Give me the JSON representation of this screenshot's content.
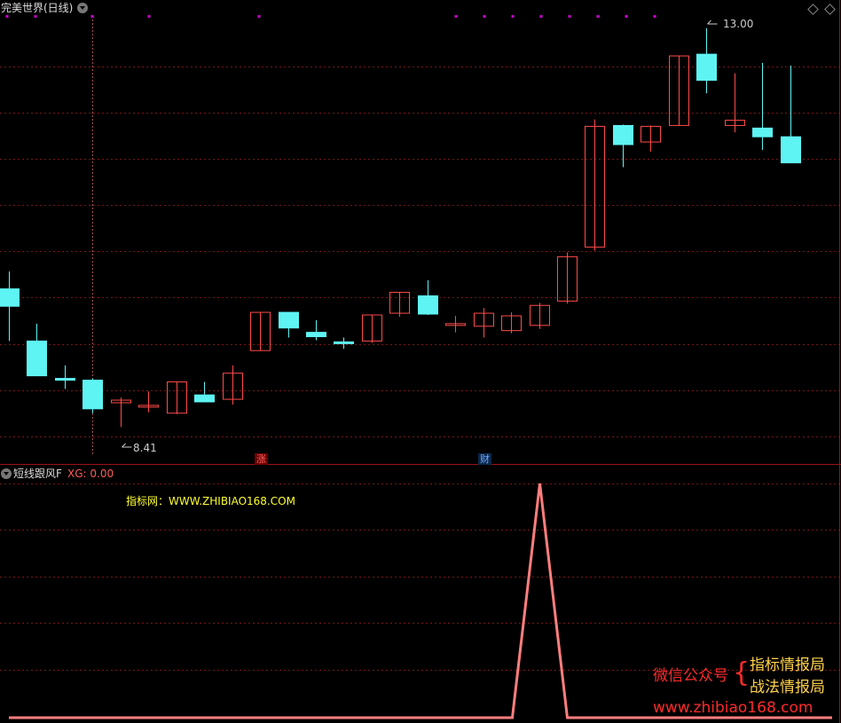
{
  "main_panel": {
    "title": "完美世界(日线)",
    "high_label": "13.00",
    "low_label": "8.41",
    "events": [
      {
        "text": "涨",
        "candle": 9
      },
      {
        "text": "财",
        "candle": 17
      }
    ]
  },
  "indicator_panel": {
    "title": "短线跟风F",
    "xg_label": "XG: 0.00",
    "watermark": "指标网：WWW.ZHIBIAO168.COM"
  },
  "branding": {
    "wechat_label": "微信公众号",
    "account_1": "指标情报局",
    "account_2": "战法情报局",
    "url": "www.zhibiao168.com"
  },
  "colors": {
    "up": "#ff4a4a",
    "down": "#5ff4f4",
    "grid": "#7a1515",
    "signal_line": "#ff7e7e",
    "marker": "#cc00cc"
  },
  "chart_data": [
    {
      "type": "candlestick",
      "title": "完美世界(日线)",
      "ylim": [
        8.2,
        13.15
      ],
      "series": [
        {
          "open": 10.0,
          "high": 10.2,
          "low": 9.4,
          "close": 9.8
        },
        {
          "open": 9.4,
          "high": 9.6,
          "low": 9.6,
          "close": 9.0
        },
        {
          "open": 8.97,
          "high": 9.12,
          "low": 8.85,
          "close": 8.95
        },
        {
          "open": 8.95,
          "high": 8.97,
          "low": 8.57,
          "close": 8.62
        },
        {
          "open": 8.69,
          "high": 8.75,
          "low": 8.41,
          "close": 8.72
        },
        {
          "open": 8.64,
          "high": 8.82,
          "low": 8.58,
          "close": 8.66
        },
        {
          "open": 8.57,
          "high": 8.93,
          "low": 8.56,
          "close": 8.93
        },
        {
          "open": 8.78,
          "high": 8.93,
          "low": 8.75,
          "close": 8.7
        },
        {
          "open": 8.73,
          "high": 9.12,
          "low": 8.67,
          "close": 9.03
        },
        {
          "open": 9.29,
          "high": 9.73,
          "low": 9.29,
          "close": 9.73
        },
        {
          "open": 9.73,
          "high": 9.65,
          "low": 9.44,
          "close": 9.55
        },
        {
          "open": 9.5,
          "high": 9.64,
          "low": 9.41,
          "close": 9.45
        },
        {
          "open": 9.39,
          "high": 9.44,
          "low": 9.31,
          "close": 9.37
        },
        {
          "open": 9.4,
          "high": 9.7,
          "low": 9.38,
          "close": 9.7
        },
        {
          "open": 9.72,
          "high": 9.91,
          "low": 9.68,
          "close": 9.96
        },
        {
          "open": 9.92,
          "high": 10.1,
          "low": 9.7,
          "close": 9.71
        },
        {
          "open": 9.6,
          "high": 9.69,
          "low": 9.5,
          "close": 9.6
        },
        {
          "open": 9.57,
          "high": 9.78,
          "low": 9.44,
          "close": 9.72
        },
        {
          "open": 9.52,
          "high": 9.73,
          "low": 9.49,
          "close": 9.69
        },
        {
          "open": 9.58,
          "high": 9.84,
          "low": 9.54,
          "close": 9.81
        },
        {
          "open": 9.86,
          "high": 10.42,
          "low": 9.83,
          "close": 10.37
        },
        {
          "open": 10.48,
          "high": 11.95,
          "low": 10.44,
          "close": 11.87
        },
        {
          "open": 11.88,
          "high": 11.89,
          "low": 11.4,
          "close": 11.66
        },
        {
          "open": 11.69,
          "high": 11.88,
          "low": 11.58,
          "close": 11.87
        },
        {
          "open": 11.88,
          "high": 12.68,
          "low": 11.88,
          "close": 12.68
        },
        {
          "open": 12.7,
          "high": 13.0,
          "low": 12.25,
          "close": 12.4
        },
        {
          "open": 11.88,
          "high": 12.48,
          "low": 11.8,
          "close": 11.94
        },
        {
          "open": 11.85,
          "high": 12.6,
          "low": 11.6,
          "close": 11.75
        },
        {
          "open": 11.75,
          "high": 12.57,
          "low": 11.45,
          "close": 11.45
        }
      ]
    },
    {
      "type": "line",
      "title": "短线跟风F",
      "series": [
        {
          "name": "XG",
          "values": [
            0,
            0,
            0,
            0,
            0,
            0,
            0,
            0,
            0,
            0,
            0,
            0,
            0,
            0,
            0,
            0,
            0,
            0,
            0,
            1,
            0,
            0,
            0,
            0,
            0,
            0,
            0,
            0,
            0
          ]
        }
      ]
    }
  ]
}
